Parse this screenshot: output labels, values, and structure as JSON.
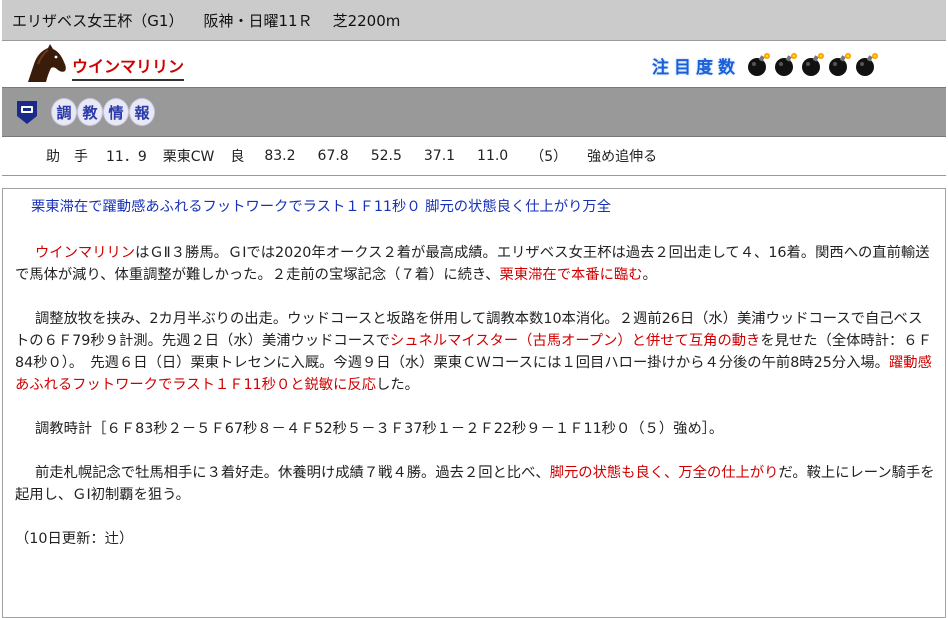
{
  "race": {
    "name": "エリザベス女王杯（G1）",
    "place": "阪神・日曜11Ｒ",
    "course": "芝2200m"
  },
  "horse": {
    "name": "ウインマリリン",
    "attention_label": "注目度数",
    "attention_level": 5
  },
  "training": {
    "title_chars": [
      "調",
      "教",
      "情",
      "報"
    ],
    "rider": "助　手",
    "date": "11．9",
    "course": "栗東CW",
    "track": "良",
    "times": [
      "83.2",
      "67.8",
      "52.5",
      "37.1",
      "11.0"
    ],
    "position": "（5）",
    "note": "強め追伸る"
  },
  "article": {
    "headline": "栗東滞在で躍動感あふれるフットワークでラスト１Ｆ11秒０ 脚元の状態良く仕上がり万全",
    "p1": {
      "red1": "ウインマリリン",
      "text1": "はＧⅡ３勝馬。ＧⅠでは2020年オークス２着が最高成績。エリザベス女王杯は過去２回出走して４、16着。関西への直前輸送で馬体が減り、体重調整が難しかった。２走前の宝塚記念（７着）に続き、",
      "red2": "栗東滞在で本番に臨む",
      "text2": "。"
    },
    "p2": {
      "text1": "調整放牧を挟み、2カ月半ぶりの出走。ウッドコースと坂路を併用して調教本数10本消化。２週前26日（水）美浦ウッドコースで自己ベストの６Ｆ79秒９計測。先週２日（水）美浦ウッドコースで",
      "red1": "シュネルマイスター（古馬オープン）と併せて互角の動き",
      "text2": "を見せた（全体時計：６Ｆ84秒０）。　先週６日（日）栗東トレセンに入厩。今週９日（水）栗東ＣＷコースには１回目ハロー掛けから４分後の午前8時25分入場。",
      "red2": "躍動感あふれるフットワークでラスト１Ｆ11秒０と鋭敏に反応",
      "text3": "した。"
    },
    "p3": "調教時計［６Ｆ83秒２－５Ｆ67秒８－４Ｆ52秒５－３Ｆ37秒１－２Ｆ22秒９－１Ｆ11秒０（５）強め］。",
    "p4": {
      "text1": "前走札幌記念で牡馬相手に３着好走。休養明け成績７戦４勝。過去２回と比べ、",
      "red1": "脚元の状態も良く、万全の仕上がり",
      "text2": "だ。鞍上にレーン騎手を起用し、ＧⅠ初制覇を狙う。"
    },
    "update": "（10日更新：辻）"
  },
  "colors": {
    "header_bg": "#cbcbcb",
    "training_bg": "#999999",
    "accent_red": "#d00000",
    "accent_blue": "#1732b8"
  }
}
